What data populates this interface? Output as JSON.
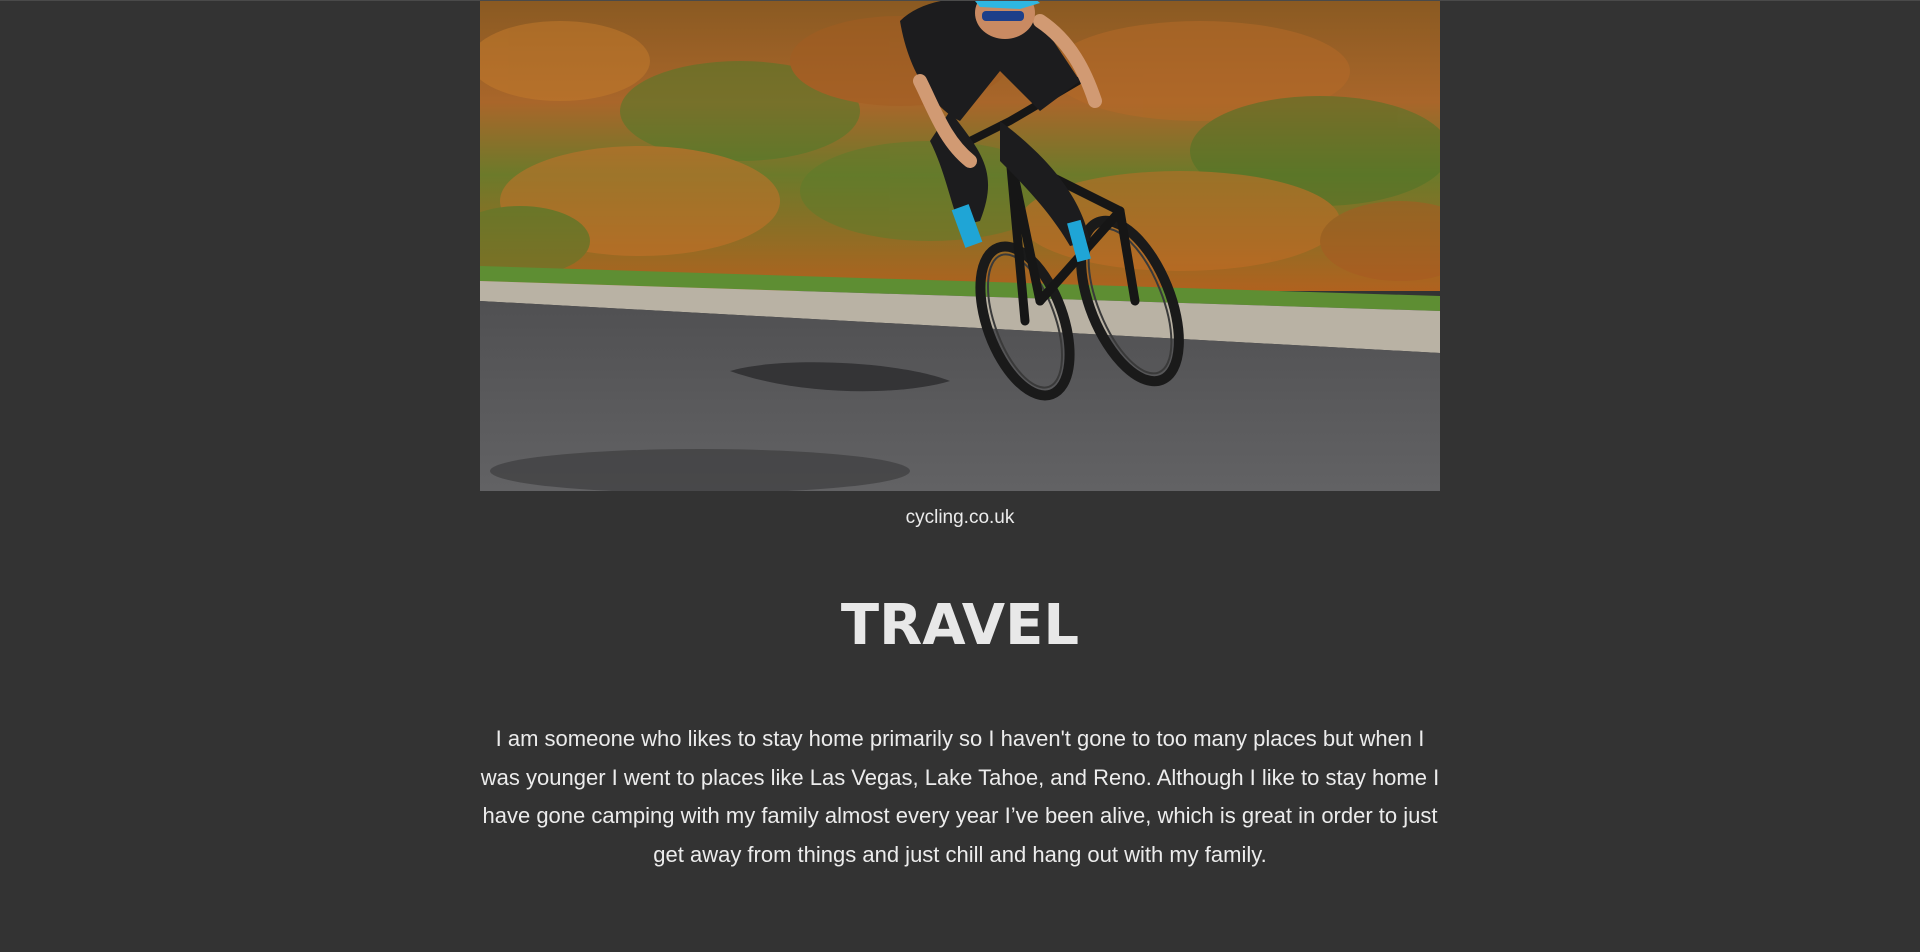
{
  "photo": {
    "caption": "cycling.co.uk"
  },
  "section": {
    "title": "TRAVEL",
    "paragraph": "I am someone who likes to stay home primarily so I haven't gone to too many places but when I was younger I went to places like Las Vegas, Lake Tahoe, and Reno. Although I like to stay home I have gone camping with my family almost every year I’ve been alive, which is great in order to just get away from things and just chill and hang out with my family."
  },
  "colors": {
    "background": "#333333",
    "text": "#ececec",
    "accent_sock": "#1fa5d6"
  }
}
